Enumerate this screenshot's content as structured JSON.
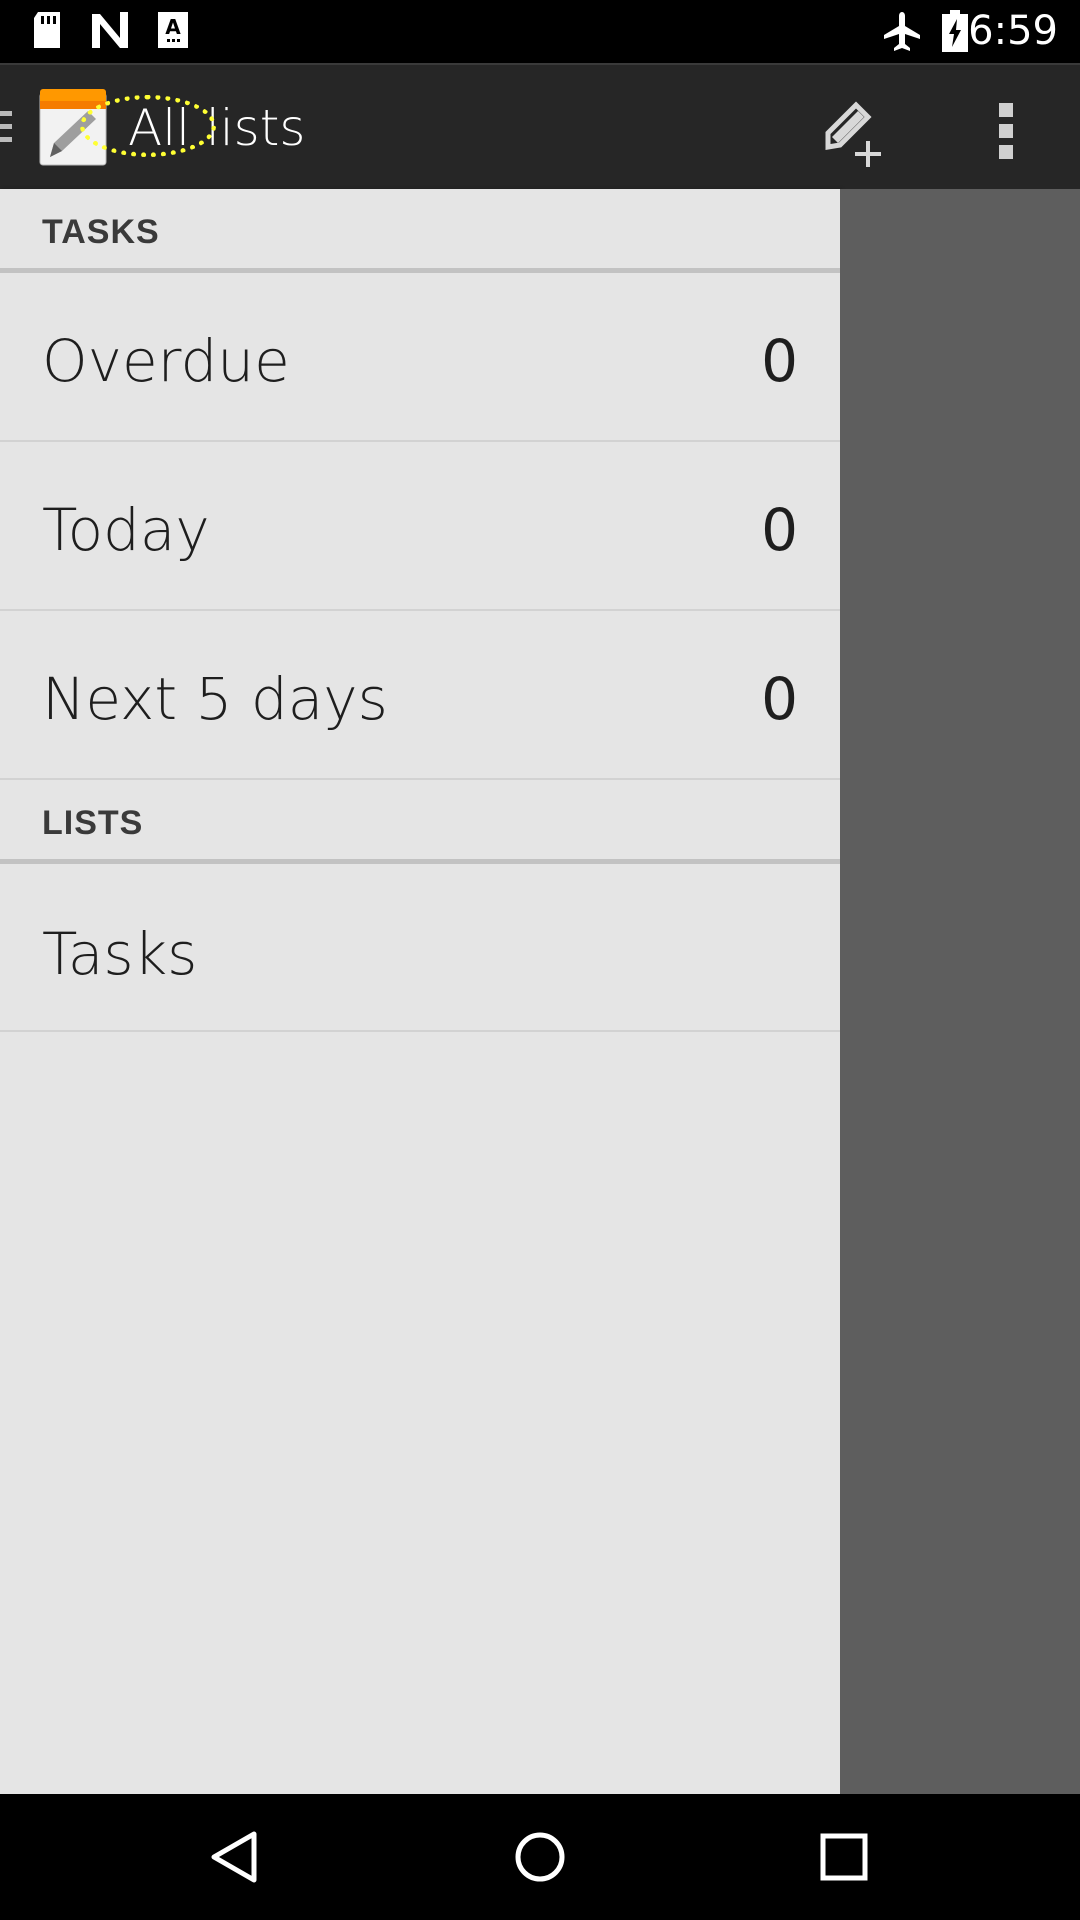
{
  "status_bar": {
    "time": "6:59",
    "icons": [
      "sd-card-icon",
      "n-logo-icon",
      "font-icon",
      "airplane-mode-icon",
      "battery-charging-icon"
    ]
  },
  "action_bar": {
    "title": "All lists",
    "icons": [
      "drawer-indicator-icon",
      "app-icon",
      "new-task-icon",
      "overflow-menu-icon"
    ],
    "highlight_color": "#ffff33"
  },
  "drawer": {
    "sections": [
      {
        "header": "TASKS",
        "items": [
          {
            "label": "Overdue",
            "count": "0"
          },
          {
            "label": "Today",
            "count": "0"
          },
          {
            "label": "Next 5 days",
            "count": "0"
          }
        ]
      },
      {
        "header": "LISTS",
        "items": [
          {
            "label": "Tasks"
          }
        ]
      }
    ]
  },
  "nav_bar": {
    "icons": [
      "back-icon",
      "home-icon",
      "recents-icon"
    ]
  },
  "colors": {
    "action_bar_bg": "#262626",
    "drawer_bg": "#e5e5e5",
    "scrim": "#5e5e5e",
    "accent": "#ff9800"
  }
}
